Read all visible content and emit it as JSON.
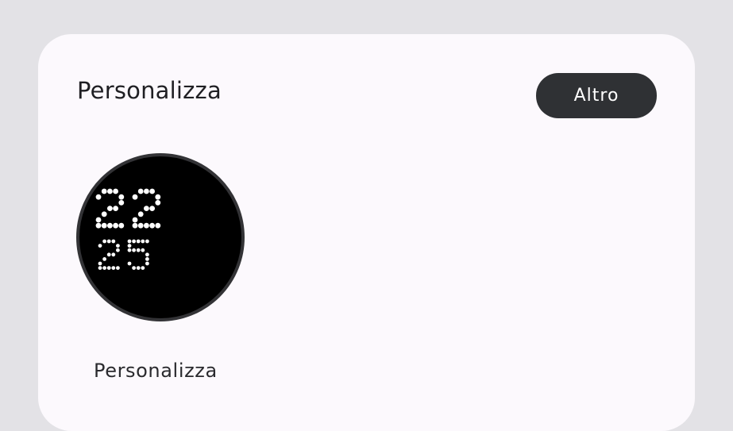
{
  "section": {
    "title": "Personalizza",
    "more_button_label": "Altro"
  },
  "watch_face": {
    "hour": "22",
    "minute": "25",
    "label": "Personalizza",
    "icon": "dot-matrix-watch-face-icon"
  },
  "colors": {
    "background": "#e3e2e6",
    "card": "#fcf9fd",
    "button": "#2f3134",
    "face": "#000000",
    "face_ring": "#333336"
  }
}
